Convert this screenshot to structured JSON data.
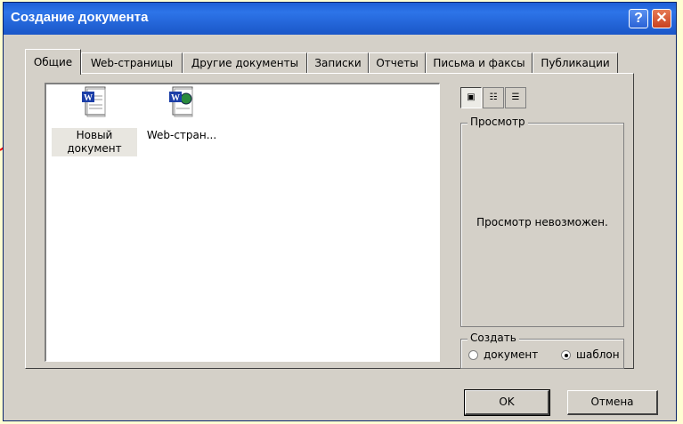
{
  "window": {
    "title": "Создание документа"
  },
  "titlebar": {
    "help_label": "?",
    "close_label": "✕"
  },
  "tabs": [
    {
      "label": "Общие",
      "active": true
    },
    {
      "label": "Web-страницы"
    },
    {
      "label": "Другие документы"
    },
    {
      "label": "Записки"
    },
    {
      "label": "Отчеты"
    },
    {
      "label": "Письма и факсы"
    },
    {
      "label": "Публикации"
    }
  ],
  "files": [
    {
      "label": "Новый документ",
      "icon": "word-document-icon",
      "selected": true
    },
    {
      "label": "Web-стран...",
      "icon": "web-page-icon"
    }
  ],
  "view_buttons": [
    {
      "icon": "large-icons-icon",
      "active": true
    },
    {
      "icon": "list-icon"
    },
    {
      "icon": "details-icon"
    }
  ],
  "preview": {
    "title": "Просмотр",
    "message": "Просмотр невозможен."
  },
  "create": {
    "title": "Создать",
    "options": [
      {
        "label": "документ",
        "checked": false
      },
      {
        "label": "шаблон",
        "checked": true
      }
    ]
  },
  "buttons": {
    "ok": "OK",
    "cancel": "Отмена"
  },
  "colors": {
    "accent": "#2d74e8",
    "background": "#fefed2",
    "annotation_arrow": "#ff0000"
  }
}
